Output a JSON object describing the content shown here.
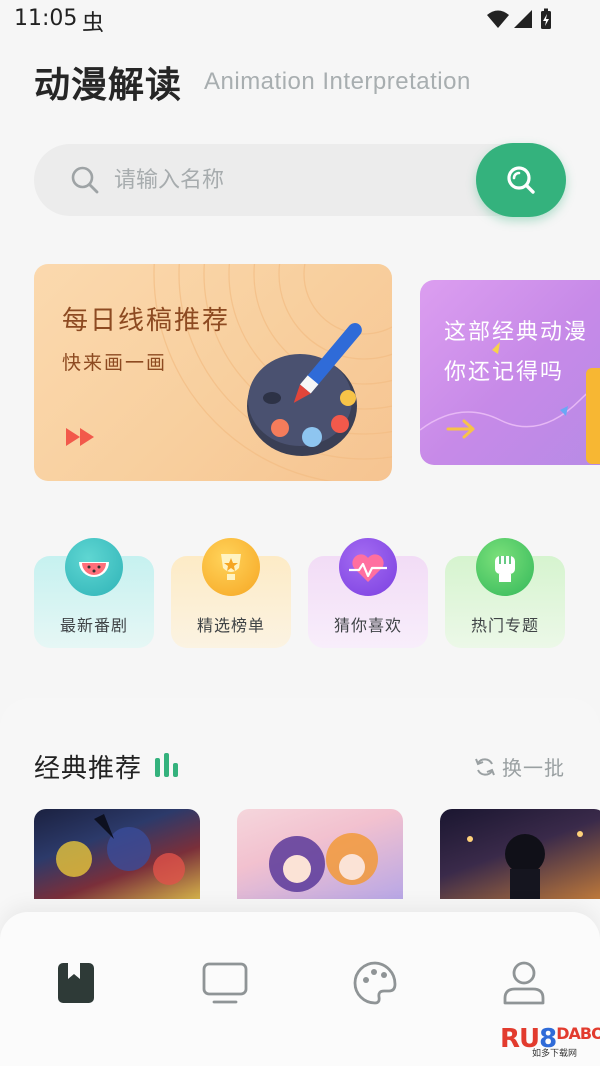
{
  "status_bar": {
    "time": "11:05",
    "bug_glyph": "虫"
  },
  "header": {
    "title": "动漫解读",
    "subtitle": "Animation Interpretation"
  },
  "search": {
    "placeholder": "请输入名称",
    "value": ""
  },
  "banners": [
    {
      "title": "每日线稿推荐",
      "subtitle": "快来画一画"
    },
    {
      "title": "这部经典动漫",
      "subtitle": "你还记得吗"
    }
  ],
  "categories": [
    {
      "label": "最新番剧",
      "icon": "watermelon-icon"
    },
    {
      "label": "精选榜单",
      "icon": "trophy-icon"
    },
    {
      "label": "猜你喜欢",
      "icon": "heart-icon"
    },
    {
      "label": "热门专题",
      "icon": "fist-icon"
    }
  ],
  "section": {
    "title": "经典推荐",
    "refresh_label": "换一批"
  },
  "nav": [
    "bookmark-icon",
    "tv-icon",
    "palette-icon",
    "user-icon"
  ],
  "watermark": {
    "text_part1": "RU",
    "text_part2": "8",
    "text_part3": "DABO",
    "sub": "如多下载网"
  },
  "colors": {
    "accent": "#34b27d",
    "banner_1": "#f8cf9e",
    "banner_2": "#c78ae8"
  }
}
